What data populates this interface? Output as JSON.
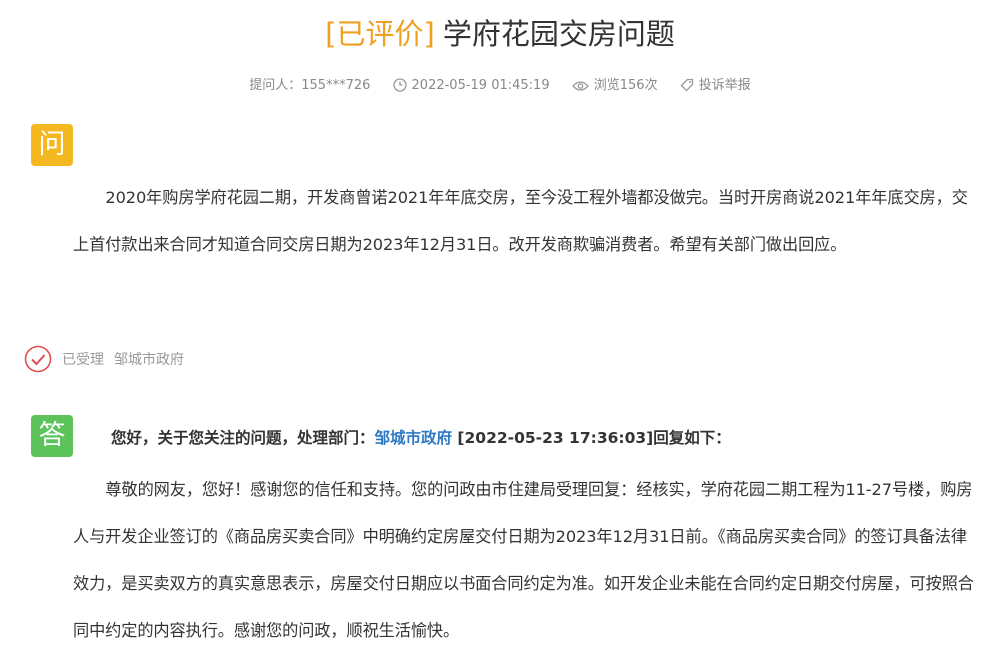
{
  "header": {
    "tag": "[已评价]",
    "title": "学府花园交房问题"
  },
  "meta": {
    "asker": "提问人：155***726",
    "datetime": "2022-05-19 01:45:19",
    "views": "浏览156次",
    "report": "投诉举报"
  },
  "question": {
    "badge": "问",
    "body": "2020年购房学府花园二期，开发商曾诺2021年年底交房，至今没工程外墙都没做完。当时开房商说2021年年底交房，交上首付款出来合同才知道合同交房日期为2023年12月31日。改开发商欺骗消费者。希望有关部门做出回应。"
  },
  "status": {
    "state": "已受理",
    "department": "邹城市政府"
  },
  "answer": {
    "badge": "答",
    "head_prefix": "您好，关于您关注的问题，处理部门：",
    "head_department": "邹城市政府",
    "head_suffix": " [2022-05-23 17:36:03]回复如下：",
    "body": "尊敬的网友，您好！感谢您的信任和支持。您的问政由市住建局受理回复：经核实，学府花园二期工程为11-27号楼，购房人与开发企业签订的《商品房买卖合同》中明确约定房屋交付日期为2023年12月31日前。《商品房买卖合同》的签订具备法律效力，是买卖双方的真实意思表示，房屋交付日期应以书面合同约定为准。如开发企业未能在合同约定日期交付房屋，可按照合同中约定的内容执行。感谢您的问政，顺祝生活愉快。"
  },
  "colors": {
    "tag": "#f0a020",
    "question_badge": "#f5b820",
    "answer_badge": "#5cc35b",
    "link": "#2e7ac4",
    "status_icon": "#e05050"
  }
}
